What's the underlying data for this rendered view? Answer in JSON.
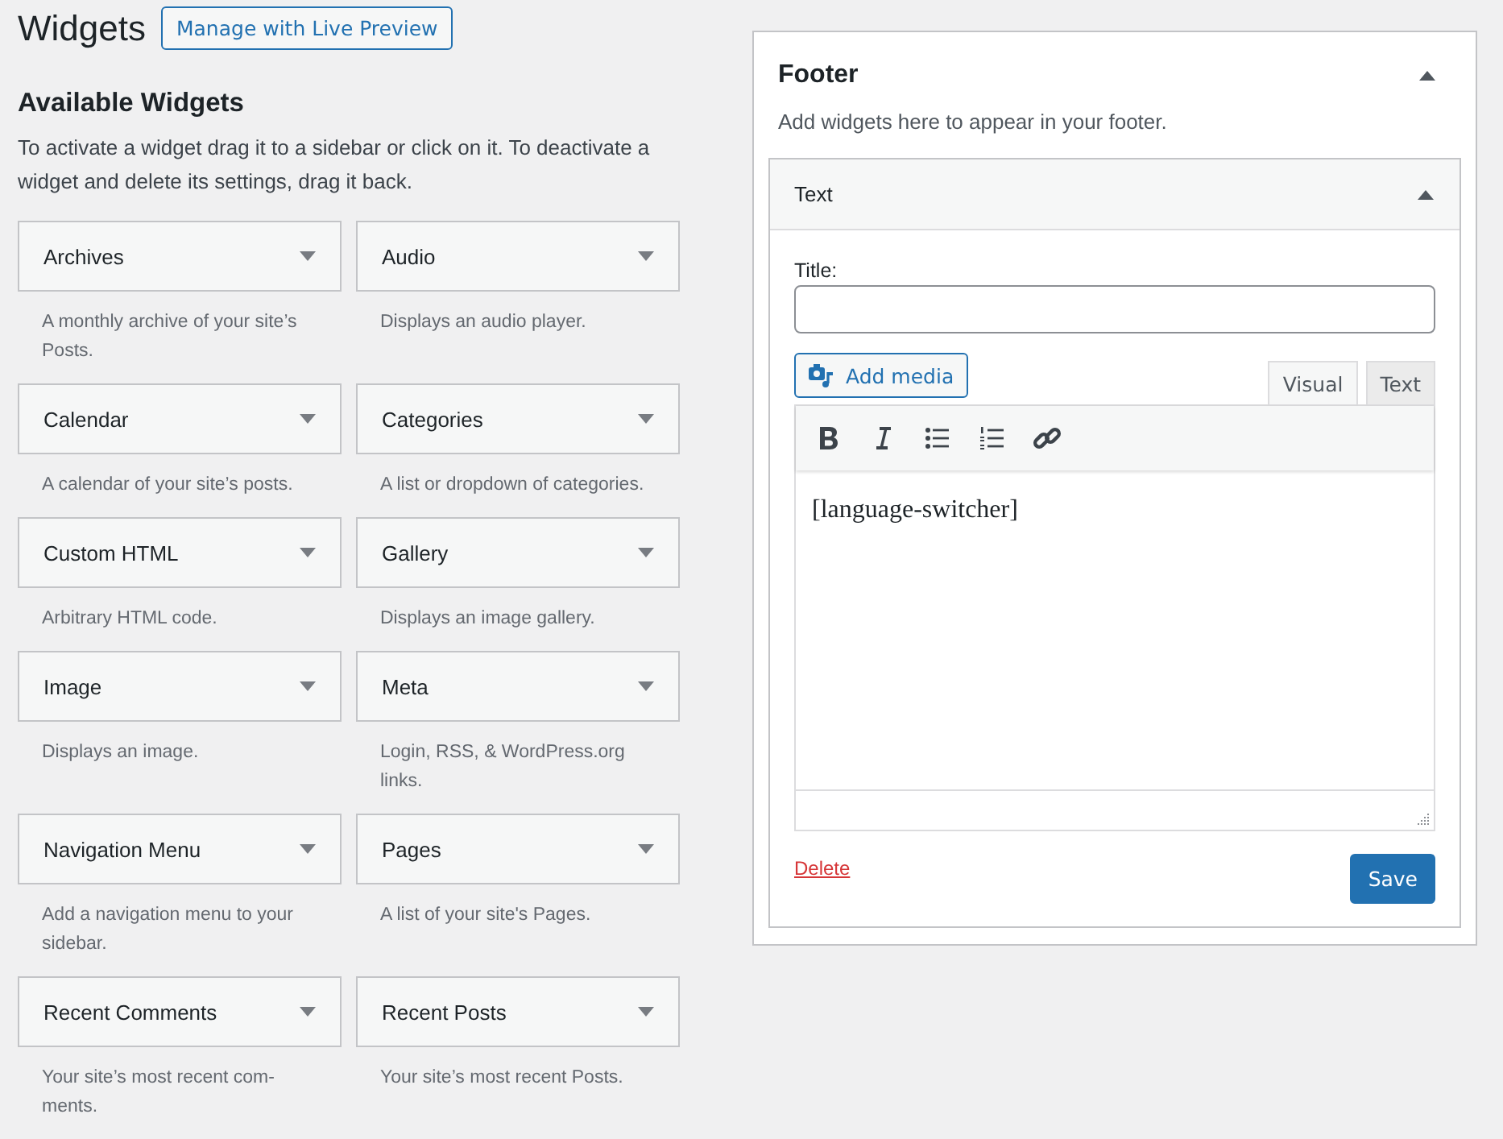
{
  "page_title": "Widgets",
  "live_preview_button": "Manage with Live Preview",
  "available": {
    "heading": "Available Widgets",
    "description": "To activate a widget drag it to a sidebar or click on it. To deactivate a widget and delete its settings, drag it back.",
    "widgets": [
      {
        "name": "Archives",
        "description": "A monthly archive of your site’s Posts."
      },
      {
        "name": "Audio",
        "description": "Displays an audio player."
      },
      {
        "name": "Calendar",
        "description": "A calendar of your site’s posts."
      },
      {
        "name": "Categories",
        "description": "A list or dropdown of categories."
      },
      {
        "name": "Custom HTML",
        "description": "Arbitrary HTML code."
      },
      {
        "name": "Gallery",
        "description": "Displays an image gallery."
      },
      {
        "name": "Image",
        "description": "Displays an image."
      },
      {
        "name": "Meta",
        "description": "Login, RSS, & WordPress.org links."
      },
      {
        "name": "Navigation Menu",
        "description": "Add a navigation menu to your sidebar."
      },
      {
        "name": "Pages",
        "description": "A list of your site's Pages."
      },
      {
        "name": "Recent Comments",
        "description": "Your site’s most recent com-ments."
      },
      {
        "name": "Recent Posts",
        "description": "Your site’s most recent Posts."
      }
    ]
  },
  "sidebar": {
    "title": "Footer",
    "expanded": true,
    "description": "Add widgets here to appear in your footer.",
    "widget": {
      "title": "Text",
      "expanded": true,
      "title_label": "Title:",
      "add_media_button": "Add media",
      "editor_tabs": [
        {
          "label": "Visual",
          "selected": true
        },
        {
          "label": "Text",
          "selected": false
        }
      ],
      "content": "[language-switcher]",
      "delete_link": "Delete",
      "save_button": "Save"
    }
  }
}
